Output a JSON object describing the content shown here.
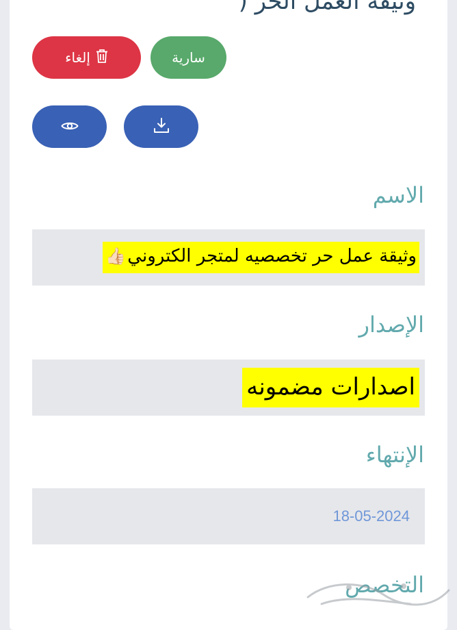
{
  "header": {
    "title": "وثيقة العمل الحر ("
  },
  "actions": {
    "cancel_label": "إلغاء",
    "status_label": "سارية",
    "view_icon": "eye-icon",
    "download_icon": "download-icon",
    "trash_icon": "trash-icon"
  },
  "fields": {
    "name": {
      "label": "الاسم",
      "value": "وثيقة عمل حر تخصصيه لمتجر الكتروني",
      "emoji": "👍🏻"
    },
    "issue": {
      "label": "الإصدار",
      "value": "اصدارات مضمونه"
    },
    "expiry": {
      "label": "الإنتهاء",
      "value": "18-05-2024"
    },
    "specialty": {
      "label": "التخصص"
    }
  },
  "colors": {
    "cancel": "#dd3545",
    "active": "#58a96b",
    "primary": "#3961b5",
    "label": "#61a9ad",
    "highlight": "#ffff00",
    "date": "#6f97d8"
  }
}
